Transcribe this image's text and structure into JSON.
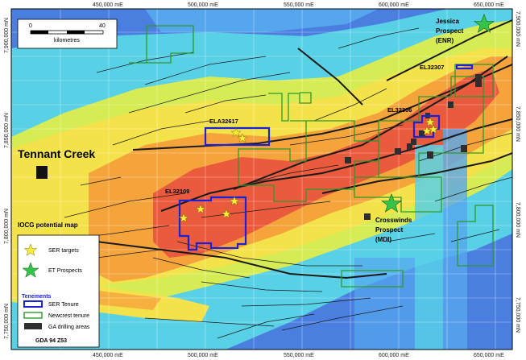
{
  "map": {
    "axes": {
      "x_ticks_top": [
        "450,000 mE",
        "500,000 mE",
        "550,000 mE",
        "600,000 mE",
        "650,000 mE"
      ],
      "x_ticks_bottom": [
        "450,000 mE",
        "500,000 mE",
        "550,000 mE",
        "600,000 mE",
        "650,000 mE"
      ],
      "y_ticks_left": [
        "7,900,000 mN",
        "7,850,000 mN",
        "7,800,000 mN",
        "7,750,000 mN"
      ],
      "y_ticks_right": [
        "7,900,000 mN",
        "7,850,000 mN",
        "7,800,000 mN",
        "7,750,000 mN"
      ]
    },
    "scale_bar": {
      "start": "0",
      "end": "40",
      "unit": "kilometres"
    },
    "labels": {
      "tennant_creek": "Tennant Creek",
      "iocg": "IOCG potential map",
      "jessica": [
        "Jessica",
        "Prospect",
        "(ENR)"
      ],
      "crosswinds": [
        "Crosswinds",
        "Prospect",
        "(MDI)"
      ]
    },
    "tenements": {
      "ela32617": "ELA32617",
      "el32109": "EL32109",
      "el32306": "EL32306",
      "el32307": "EL32307"
    },
    "legend": {
      "ser_targets": "SER targets",
      "et_prospects": "ET Prospects",
      "tenements_heading": "Tenements",
      "ser_tenure": "SER Tenure",
      "newcrest_tenure": "Newcrest tenure",
      "ga_drilling": "GA drilling areas",
      "datum": "GDA 94 Z53"
    },
    "colors": {
      "blue_deep": "#4a7fe0",
      "blue": "#56a6ee",
      "cyan": "#58d0e6",
      "green_yellow": "#d7ec54",
      "yellow": "#f4e24a",
      "orange": "#f5a43c",
      "red": "#ea5a3c",
      "ser_tenure": "#1a22d6",
      "newcrest_tenure": "#2f9a2a",
      "ga_drilling": "#2e2e2e",
      "star_ser": "#f6ef3a",
      "star_et": "#35c44a"
    },
    "icons": {
      "ser_target": "star-icon",
      "et_prospect": "star-icon",
      "town": "square-icon"
    }
  }
}
